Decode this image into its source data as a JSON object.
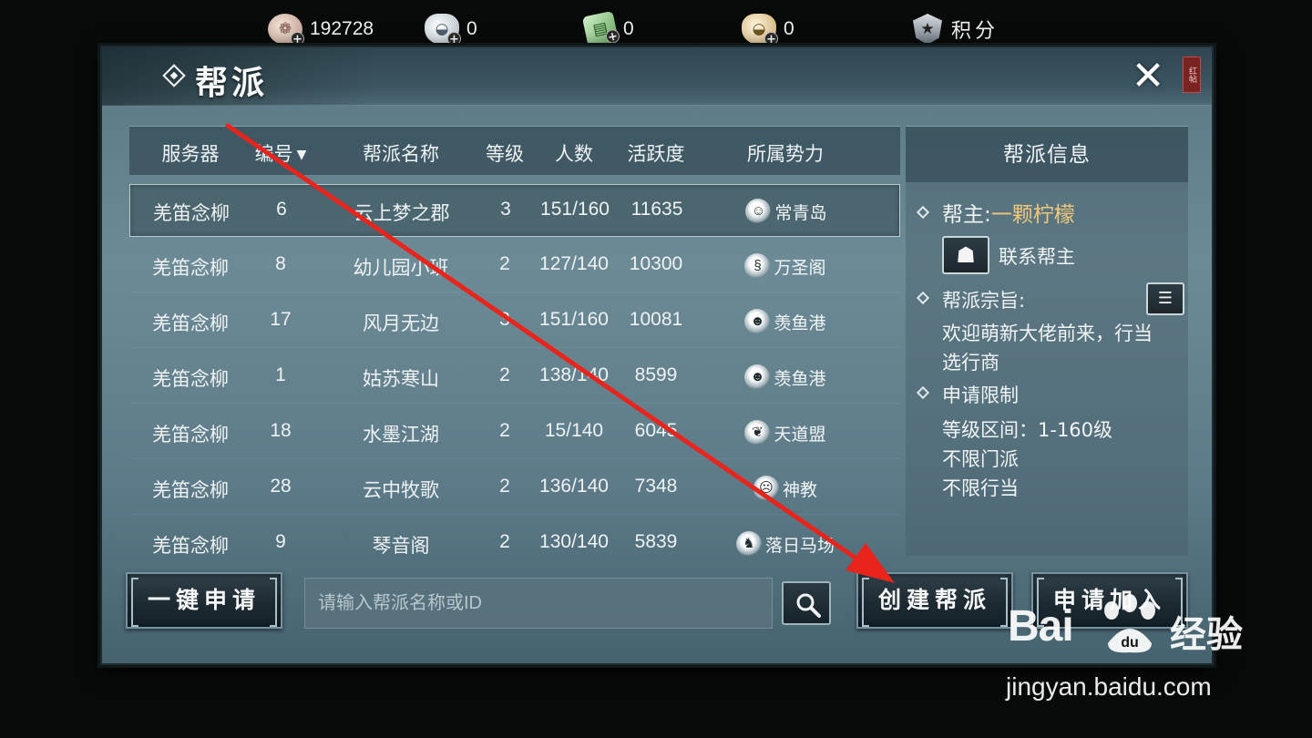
{
  "resources": {
    "coin": {
      "value": "192728",
      "icon": "coin-icon"
    },
    "silver": {
      "value": "0",
      "icon": "silver-ingot-icon"
    },
    "ticket": {
      "value": "0",
      "icon": "ticket-icon"
    },
    "gold": {
      "value": "0",
      "icon": "gold-ingot-icon"
    },
    "score": {
      "label": "积分",
      "icon": "shield-icon"
    }
  },
  "dialog": {
    "title": "帮派",
    "close_icon": "close-icon",
    "seal_text": "红帖"
  },
  "list": {
    "headers": {
      "server": "服务器",
      "number": "编号",
      "name": "帮派名称",
      "level": "等级",
      "people": "人数",
      "activity": "活跃度",
      "faction": "所属势力"
    },
    "rows": [
      {
        "server": "羌笛念柳",
        "number": "6",
        "name": "云上梦之郡",
        "level": "3",
        "people": "151/160",
        "activity": "11635",
        "faction": "常青岛",
        "faction_icon": "evergreen-island-icon"
      },
      {
        "server": "羌笛念柳",
        "number": "8",
        "name": "幼儿园小班",
        "level": "2",
        "people": "127/140",
        "activity": "10300",
        "faction": "万圣阁",
        "faction_icon": "dragon-icon"
      },
      {
        "server": "羌笛念柳",
        "number": "17",
        "name": "风月无边",
        "level": "3",
        "people": "151/160",
        "activity": "10081",
        "faction": "羡鱼港",
        "faction_icon": "masked-figure-icon"
      },
      {
        "server": "羌笛念柳",
        "number": "1",
        "name": "姑苏寒山",
        "level": "2",
        "people": "138/140",
        "activity": "8599",
        "faction": "羡鱼港",
        "faction_icon": "masked-figure-icon"
      },
      {
        "server": "羌笛念柳",
        "number": "18",
        "name": "水墨江湖",
        "level": "2",
        "people": "15/140",
        "activity": "6045",
        "faction": "天道盟",
        "faction_icon": "beast-icon"
      },
      {
        "server": "羌笛念柳",
        "number": "28",
        "name": "云中牧歌",
        "level": "2",
        "people": "136/140",
        "activity": "7348",
        "faction": "神教",
        "faction_icon": "mask-icon"
      },
      {
        "server": "羌笛念柳",
        "number": "9",
        "name": "琴音阁",
        "level": "2",
        "people": "130/140",
        "activity": "5839",
        "faction": "落日马场",
        "faction_icon": "horse-icon"
      }
    ]
  },
  "info": {
    "title": "帮派信息",
    "leader_label": "帮主:",
    "leader_name": "一颗柠檬",
    "contact_label": "联系帮主",
    "purpose_label": "帮派宗旨:",
    "purpose_line1": "欢迎萌新大佬前来，行当",
    "purpose_line2": "选行商",
    "limit_label": "申请限制",
    "limit_level": "等级区间：1-160级",
    "limit_school": "不限门派",
    "limit_trade": "不限行当"
  },
  "controls": {
    "one_click_apply": "一键申请",
    "search_placeholder": "请输入帮派名称或ID",
    "create_guild": "创建帮派",
    "apply_join": "申请加入"
  },
  "watermark": {
    "brand": "Bai",
    "brand_suffix": "du",
    "cn": "经验",
    "url": "jingyan.baidu.com"
  },
  "colors": {
    "leader_name": "#f0c77a",
    "annotation_arrow": "#e8241c",
    "panel": "#6d8b96"
  }
}
